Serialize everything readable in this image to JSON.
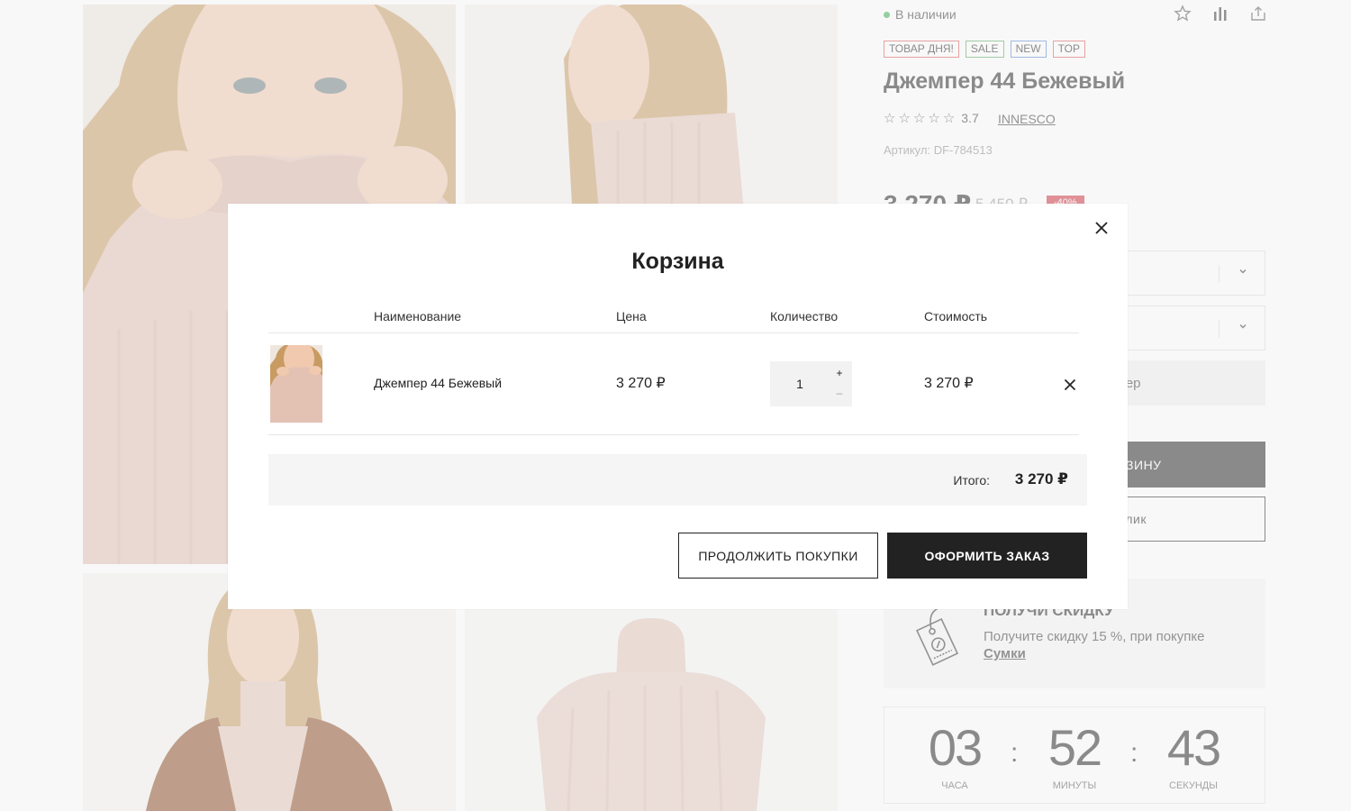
{
  "product": {
    "stock_status": "В наличии",
    "badges": [
      "ТОВАР ДНЯ!",
      "SALE",
      "NEW",
      "TOP"
    ],
    "title": "Джемпер 44 Бежевый",
    "rating": 3.7,
    "rating_text": "3.7",
    "brand": "INNESCO",
    "sku": "Артикул: DF-784513",
    "price": "3 270 ₽",
    "old_price": "5 450 ₽",
    "discount": "-40%",
    "size_button": "мер",
    "cart_button": "В КОРЗИНУ",
    "oneclick_button": "дин клик",
    "icons": [
      "star-icon",
      "compare-bars-icon",
      "share-icon"
    ]
  },
  "promo": {
    "title": "ПОЛУЧИ СКИДКУ",
    "text": "Получите скидку 15 %, при покупке",
    "link": "Сумки"
  },
  "timer": {
    "hours": "03",
    "minutes": "52",
    "seconds": "43",
    "hours_label": "ЧАСА",
    "minutes_label": "МИНУТЫ",
    "seconds_label": "СЕКУНДЫ"
  },
  "modal": {
    "title": "Корзина",
    "columns": [
      "Наименование",
      "Цена",
      "Количество",
      "Стоимость"
    ],
    "items": [
      {
        "name": "Джемпер 44 Бежевый",
        "price": "3 270 ₽",
        "qty": "1",
        "total": "3 270 ₽"
      }
    ],
    "qty_plus": "+",
    "qty_minus": "–",
    "summary_label": "Итого:",
    "summary_value": "3 270 ₽",
    "continue_button": "ПРОДОЛЖИТЬ ПОКУПКИ",
    "checkout_button": "ОФОРМИТЬ ЗАКАЗ"
  },
  "colors": {
    "accent_dark": "#222222",
    "stock_green": "#34b04a",
    "discount_red": "#d0303a"
  }
}
